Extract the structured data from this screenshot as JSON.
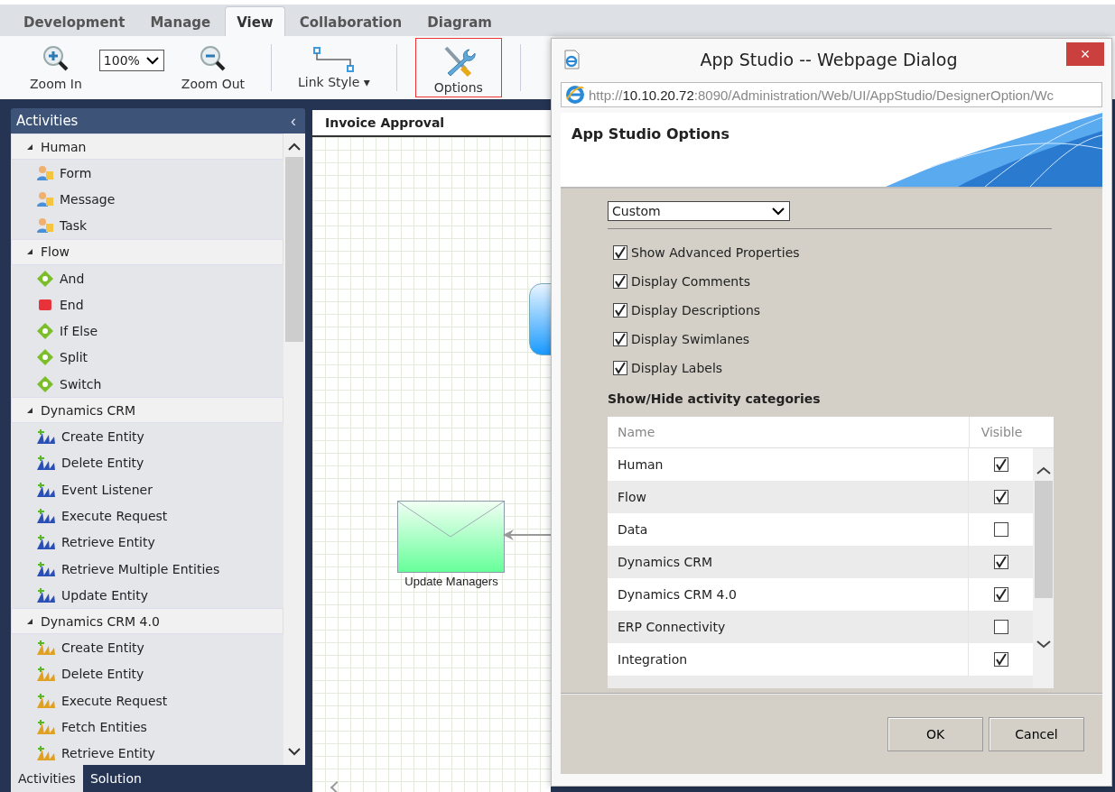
{
  "ribbon_tabs": [
    {
      "label": "Development",
      "selected": false
    },
    {
      "label": "Manage",
      "selected": false
    },
    {
      "label": "View",
      "selected": true
    },
    {
      "label": "Collaboration",
      "selected": false
    },
    {
      "label": "Diagram",
      "selected": false
    }
  ],
  "toolbar": {
    "zoom_in": {
      "label": "Zoom In"
    },
    "zoom_select": {
      "value": "100%"
    },
    "zoom_out": {
      "label": "Zoom Out"
    },
    "link_style": {
      "label": "Link Style",
      "caret": "▾"
    },
    "options": {
      "label": "Options",
      "highlighted": true
    }
  },
  "sidebar": {
    "title": "Activities",
    "collapse": "‹",
    "categories": [
      {
        "name": "Human",
        "expanded": true,
        "items": [
          {
            "label": "Form",
            "kind": "person"
          },
          {
            "label": "Message",
            "kind": "person"
          },
          {
            "label": "Task",
            "kind": "person"
          }
        ]
      },
      {
        "name": "Flow",
        "expanded": true,
        "items": [
          {
            "label": "And",
            "kind": "diamond"
          },
          {
            "label": "End",
            "kind": "stop"
          },
          {
            "label": "If Else",
            "kind": "diamond"
          },
          {
            "label": "Split",
            "kind": "diamond"
          },
          {
            "label": "Switch",
            "kind": "diamond"
          }
        ]
      },
      {
        "name": "Dynamics CRM",
        "expanded": true,
        "items": [
          {
            "label": "Create Entity",
            "kind": "crm"
          },
          {
            "label": "Delete Entity",
            "kind": "crm"
          },
          {
            "label": "Event Listener",
            "kind": "crm"
          },
          {
            "label": "Execute Request",
            "kind": "crm"
          },
          {
            "label": "Retrieve Entity",
            "kind": "crm"
          },
          {
            "label": "Retrieve Multiple Entities",
            "kind": "crm"
          },
          {
            "label": "Update Entity",
            "kind": "crm"
          }
        ]
      },
      {
        "name": "Dynamics CRM 4.0",
        "expanded": true,
        "items": [
          {
            "label": "Create Entity",
            "kind": "crm4"
          },
          {
            "label": "Delete Entity",
            "kind": "crm4"
          },
          {
            "label": "Execute Request",
            "kind": "crm4"
          },
          {
            "label": "Fetch Entities",
            "kind": "crm4"
          },
          {
            "label": "Retrieve Entity",
            "kind": "crm4"
          }
        ]
      }
    ],
    "bottom_tabs": [
      {
        "label": "Activities",
        "selected": true
      },
      {
        "label": "Solution",
        "selected": false
      }
    ]
  },
  "canvas": {
    "title": "Invoice Approval",
    "node_label": "Update Managers"
  },
  "dialog": {
    "title": "App Studio -- Webpage Dialog",
    "close": "×",
    "url": {
      "scheme": "http://",
      "host": "10.10.20.72",
      "path": ":8090/Administration/Web/UI/AppStudio/DesignerOption/Wc"
    },
    "heading": "App Studio Options",
    "preset": {
      "value": "Custom"
    },
    "options": [
      {
        "label": "Show Advanced Properties",
        "checked": true
      },
      {
        "label": "Display Comments",
        "checked": true
      },
      {
        "label": "Display Descriptions",
        "checked": true
      },
      {
        "label": "Display Swimlanes",
        "checked": true
      },
      {
        "label": "Display Labels",
        "checked": true
      }
    ],
    "categories_heading": "Show/Hide activity categories",
    "table": {
      "columns": [
        "Name",
        "Visible"
      ],
      "rows": [
        {
          "name": "Human",
          "visible": true
        },
        {
          "name": "Flow",
          "visible": true
        },
        {
          "name": "Data",
          "visible": false
        },
        {
          "name": "Dynamics CRM",
          "visible": true
        },
        {
          "name": "Dynamics CRM 4.0",
          "visible": true
        },
        {
          "name": "ERP Connectivity",
          "visible": false
        },
        {
          "name": "Integration",
          "visible": true
        }
      ]
    },
    "buttons": [
      "OK",
      "Cancel"
    ]
  }
}
